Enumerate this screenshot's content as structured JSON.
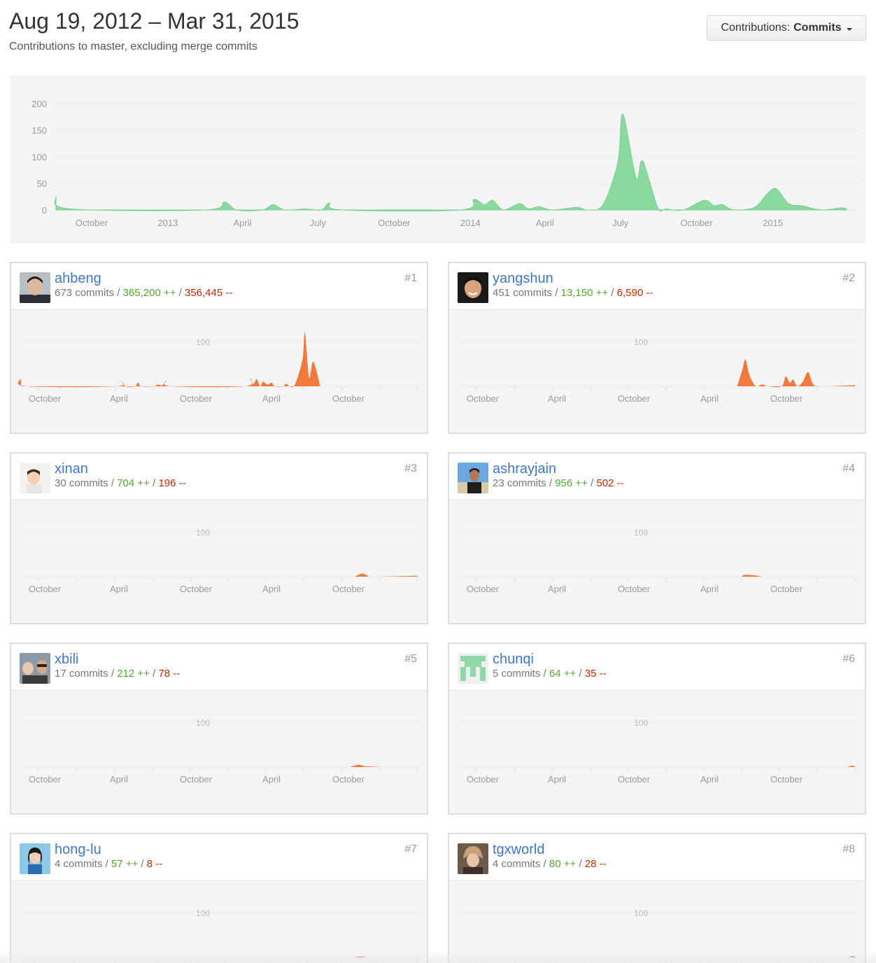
{
  "header": {
    "date_range": "Aug 19, 2012 – Mar 31, 2015",
    "subtitle": "Contributions to master, excluding merge commits",
    "contrib_prefix": "Contributions:",
    "contrib_value": "Commits"
  },
  "colors": {
    "main_area": "#8cd9a0",
    "mini_area": "#f07a3c",
    "link": "#4078c0",
    "additions": "#55a532",
    "deletions": "#bd2c00"
  },
  "chart_data": {
    "type": "area",
    "title": "",
    "ylim": [
      0,
      200
    ],
    "y_ticks": [
      "200",
      "150",
      "100",
      "50",
      "0"
    ],
    "x_ticks": [
      "October",
      "2013",
      "April",
      "July",
      "October",
      "2014",
      "April",
      "July",
      "October",
      "2015"
    ],
    "x_tick_dates": [
      "2012-10-01",
      "2013-01-01",
      "2013-04-01",
      "2013-07-01",
      "2013-10-01",
      "2014-01-01",
      "2014-04-01",
      "2014-07-01",
      "2014-10-01",
      "2015-01-01"
    ],
    "series": [
      {
        "values": [
          {
            "x": "2012-08-19",
            "y": 25
          },
          {
            "x": "2012-09-05",
            "y": 2
          },
          {
            "x": "2013-02-15",
            "y": 0
          },
          {
            "x": "2013-03-10",
            "y": 15
          },
          {
            "x": "2013-03-25",
            "y": 0
          },
          {
            "x": "2013-04-25",
            "y": 0
          },
          {
            "x": "2013-05-08",
            "y": 10
          },
          {
            "x": "2013-05-22",
            "y": 0
          },
          {
            "x": "2013-06-15",
            "y": 2
          },
          {
            "x": "2013-07-05",
            "y": 0
          },
          {
            "x": "2013-07-15",
            "y": 13
          },
          {
            "x": "2013-07-30",
            "y": 0
          },
          {
            "x": "2013-12-20",
            "y": 0
          },
          {
            "x": "2014-01-05",
            "y": 20
          },
          {
            "x": "2014-01-18",
            "y": 10
          },
          {
            "x": "2014-01-28",
            "y": 18
          },
          {
            "x": "2014-02-10",
            "y": 0
          },
          {
            "x": "2014-03-01",
            "y": 12
          },
          {
            "x": "2014-03-12",
            "y": 2
          },
          {
            "x": "2014-03-25",
            "y": 6
          },
          {
            "x": "2014-04-10",
            "y": 0
          },
          {
            "x": "2014-05-10",
            "y": 5
          },
          {
            "x": "2014-05-22",
            "y": 0
          },
          {
            "x": "2014-06-10",
            "y": 10
          },
          {
            "x": "2014-06-28",
            "y": 90
          },
          {
            "x": "2014-07-04",
            "y": 180
          },
          {
            "x": "2014-07-20",
            "y": 60
          },
          {
            "x": "2014-07-28",
            "y": 92
          },
          {
            "x": "2014-08-15",
            "y": 5
          },
          {
            "x": "2014-08-25",
            "y": 2
          },
          {
            "x": "2014-09-15",
            "y": 0
          },
          {
            "x": "2014-10-10",
            "y": 18
          },
          {
            "x": "2014-10-22",
            "y": 8
          },
          {
            "x": "2014-11-01",
            "y": 10
          },
          {
            "x": "2014-11-15",
            "y": 0
          },
          {
            "x": "2014-12-10",
            "y": 5
          },
          {
            "x": "2014-12-25",
            "y": 30
          },
          {
            "x": "2015-01-05",
            "y": 40
          },
          {
            "x": "2015-01-20",
            "y": 12
          },
          {
            "x": "2015-02-05",
            "y": 8
          },
          {
            "x": "2015-02-20",
            "y": 2
          },
          {
            "x": "2015-03-05",
            "y": 0
          },
          {
            "x": "2015-03-25",
            "y": 4
          },
          {
            "x": "2015-03-31",
            "y": 2
          }
        ]
      }
    ]
  },
  "mini_axis": {
    "y_label": "100",
    "x_ticks": [
      "October",
      "April",
      "October",
      "April",
      "October"
    ]
  },
  "contributors": [
    {
      "name": "ahbeng",
      "commits": "673 commits",
      "additions": "365,200 ++",
      "deletions": "356,445 --",
      "rank": "#1",
      "avatar": "avatar-face-dark",
      "data": [
        {
          "x": "2012-08-19",
          "y": 18
        },
        {
          "x": "2012-09-01",
          "y": 0
        },
        {
          "x": "2013-04-05",
          "y": 0
        },
        {
          "x": "2013-04-15",
          "y": 12
        },
        {
          "x": "2013-04-28",
          "y": 0
        },
        {
          "x": "2013-05-20",
          "y": 0
        },
        {
          "x": "2013-05-28",
          "y": 8
        },
        {
          "x": "2013-06-05",
          "y": 0
        },
        {
          "x": "2013-07-05",
          "y": 0
        },
        {
          "x": "2013-07-15",
          "y": 4
        },
        {
          "x": "2013-07-25",
          "y": 2
        },
        {
          "x": "2013-08-05",
          "y": 13
        },
        {
          "x": "2013-08-15",
          "y": 0
        },
        {
          "x": "2014-02-10",
          "y": 0
        },
        {
          "x": "2014-02-22",
          "y": 18
        },
        {
          "x": "2014-03-02",
          "y": 5
        },
        {
          "x": "2014-03-10",
          "y": 16
        },
        {
          "x": "2014-03-18",
          "y": 0
        },
        {
          "x": "2014-03-25",
          "y": 10
        },
        {
          "x": "2014-04-05",
          "y": 4
        },
        {
          "x": "2014-04-15",
          "y": 8
        },
        {
          "x": "2014-04-22",
          "y": 0
        },
        {
          "x": "2014-05-12",
          "y": 0
        },
        {
          "x": "2014-05-20",
          "y": 6
        },
        {
          "x": "2014-05-28",
          "y": 0
        },
        {
          "x": "2014-06-10",
          "y": 4
        },
        {
          "x": "2014-06-28",
          "y": 60
        },
        {
          "x": "2014-07-04",
          "y": 120
        },
        {
          "x": "2014-07-14",
          "y": 20
        },
        {
          "x": "2014-07-24",
          "y": 55
        },
        {
          "x": "2014-08-10",
          "y": 0
        }
      ]
    },
    {
      "name": "yangshun",
      "commits": "451 commits",
      "additions": "13,150 ++",
      "deletions": "6,590 --",
      "rank": "#2",
      "avatar": "avatar-face-smile",
      "data": [
        {
          "x": "2014-06-20",
          "y": 0
        },
        {
          "x": "2014-07-02",
          "y": 35
        },
        {
          "x": "2014-07-10",
          "y": 60
        },
        {
          "x": "2014-07-18",
          "y": 30
        },
        {
          "x": "2014-07-26",
          "y": 12
        },
        {
          "x": "2014-08-05",
          "y": 0
        },
        {
          "x": "2014-08-20",
          "y": 4
        },
        {
          "x": "2014-09-01",
          "y": 0
        },
        {
          "x": "2014-10-05",
          "y": 0
        },
        {
          "x": "2014-10-15",
          "y": 22
        },
        {
          "x": "2014-10-25",
          "y": 8
        },
        {
          "x": "2014-11-02",
          "y": 15
        },
        {
          "x": "2014-11-12",
          "y": 0
        },
        {
          "x": "2014-11-25",
          "y": 10
        },
        {
          "x": "2014-12-08",
          "y": 32
        },
        {
          "x": "2014-12-20",
          "y": 5
        },
        {
          "x": "2015-01-05",
          "y": 0
        },
        {
          "x": "2015-03-20",
          "y": 2
        },
        {
          "x": "2015-03-31",
          "y": 3
        }
      ]
    },
    {
      "name": "xinan",
      "commits": "30 commits",
      "additions": "704 ++",
      "deletions": "196 --",
      "rank": "#3",
      "avatar": "avatar-child",
      "data": [
        {
          "x": "2014-11-01",
          "y": 0
        },
        {
          "x": "2014-11-18",
          "y": 7
        },
        {
          "x": "2014-12-01",
          "y": 3
        },
        {
          "x": "2014-12-12",
          "y": 0
        },
        {
          "x": "2015-03-25",
          "y": 2
        },
        {
          "x": "2015-03-31",
          "y": 1
        }
      ]
    },
    {
      "name": "ashrayjain",
      "commits": "23 commits",
      "additions": "956 ++",
      "deletions": "502 --",
      "rank": "#4",
      "avatar": "avatar-beach",
      "data": [
        {
          "x": "2014-07-01",
          "y": 0
        },
        {
          "x": "2014-07-08",
          "y": 4
        },
        {
          "x": "2014-08-01",
          "y": 3
        },
        {
          "x": "2014-08-18",
          "y": 0
        }
      ]
    },
    {
      "name": "xbili",
      "commits": "17 commits",
      "additions": "212 ++",
      "deletions": "78 --",
      "rank": "#5",
      "avatar": "avatar-group",
      "data": [
        {
          "x": "2014-10-20",
          "y": 0
        },
        {
          "x": "2014-11-10",
          "y": 5
        },
        {
          "x": "2014-11-25",
          "y": 2
        },
        {
          "x": "2014-12-15",
          "y": 1
        },
        {
          "x": "2015-01-05",
          "y": 0
        }
      ]
    },
    {
      "name": "chunqi",
      "commits": "5 commits",
      "additions": "64 ++",
      "deletions": "35 --",
      "rank": "#6",
      "avatar": "avatar-identicon",
      "data": [
        {
          "x": "2015-03-10",
          "y": 0
        },
        {
          "x": "2015-03-25",
          "y": 3
        },
        {
          "x": "2015-03-31",
          "y": 1
        }
      ]
    },
    {
      "name": "hong-lu",
      "commits": "4 commits",
      "additions": "57 ++",
      "deletions": "8 --",
      "rank": "#7",
      "avatar": "avatar-woman",
      "data": [
        {
          "x": "2014-11-01",
          "y": 0
        },
        {
          "x": "2014-11-15",
          "y": 2
        },
        {
          "x": "2014-12-01",
          "y": 0
        }
      ]
    },
    {
      "name": "tgxworld",
      "commits": "4 commits",
      "additions": "80 ++",
      "deletions": "28 --",
      "rank": "#8",
      "avatar": "avatar-hat",
      "data": [
        {
          "x": "2015-03-15",
          "y": 0
        },
        {
          "x": "2015-03-25",
          "y": 3
        },
        {
          "x": "2015-03-31",
          "y": 1
        }
      ]
    }
  ]
}
